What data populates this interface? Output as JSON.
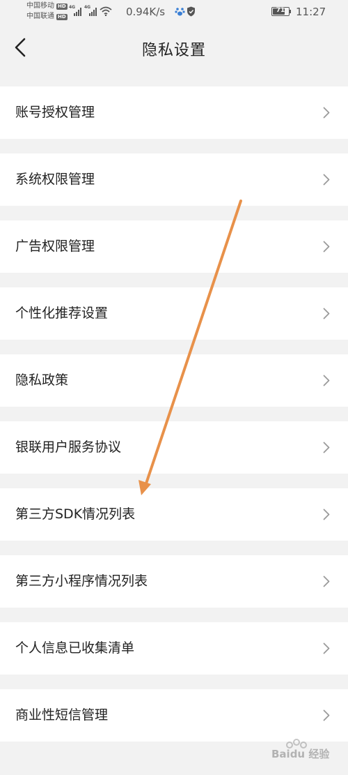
{
  "status_bar": {
    "carrier_1": "中国移动",
    "carrier_2": "中国联通",
    "hd_badge": "HD",
    "network_tag": "4G",
    "net_speed": "0.94K/s",
    "battery_level": "71",
    "time": "11:27"
  },
  "nav": {
    "title": "隐私设置"
  },
  "settings": {
    "items": [
      {
        "label": "账号授权管理"
      },
      {
        "label": "系统权限管理"
      },
      {
        "label": "广告权限管理"
      },
      {
        "label": "个性化推荐设置"
      },
      {
        "label": "隐私政策"
      },
      {
        "label": "银联用户服务协议"
      },
      {
        "label": "第三方SDK情况列表"
      },
      {
        "label": "第三方小程序情况列表"
      },
      {
        "label": "个人信息已收集清单"
      },
      {
        "label": "商业性短信管理"
      }
    ]
  },
  "watermark": {
    "text": "Baidu 经验"
  },
  "colors": {
    "background": "#f2f2f2",
    "card": "#ffffff",
    "annotation_arrow": "#e8914a",
    "chevron": "#9a9a9a"
  }
}
